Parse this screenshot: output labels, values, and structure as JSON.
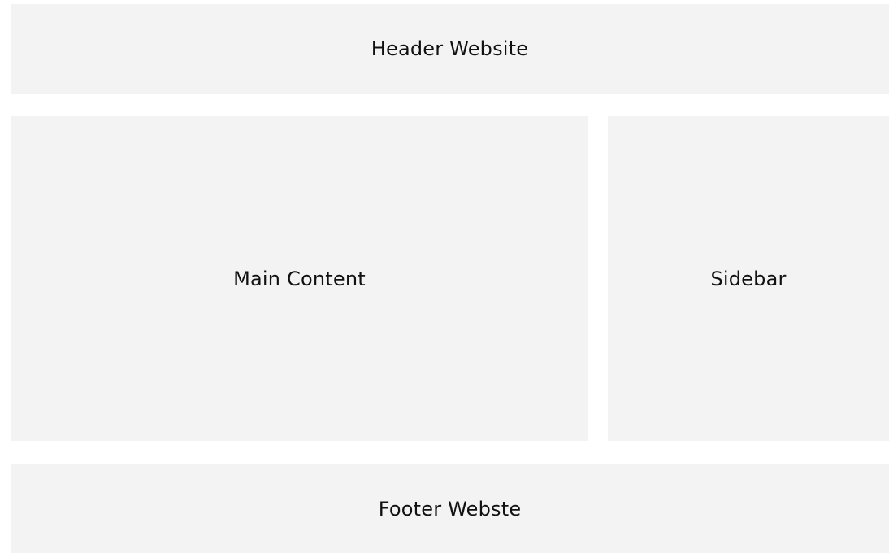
{
  "layout": {
    "header": {
      "label": "Header Website"
    },
    "main": {
      "label": "Main Content"
    },
    "sidebar": {
      "label": "Sidebar"
    },
    "footer": {
      "label": "Footer Webste"
    }
  },
  "colors": {
    "background": "#ffffff",
    "block": "#f3f3f3",
    "text": "#111111"
  }
}
